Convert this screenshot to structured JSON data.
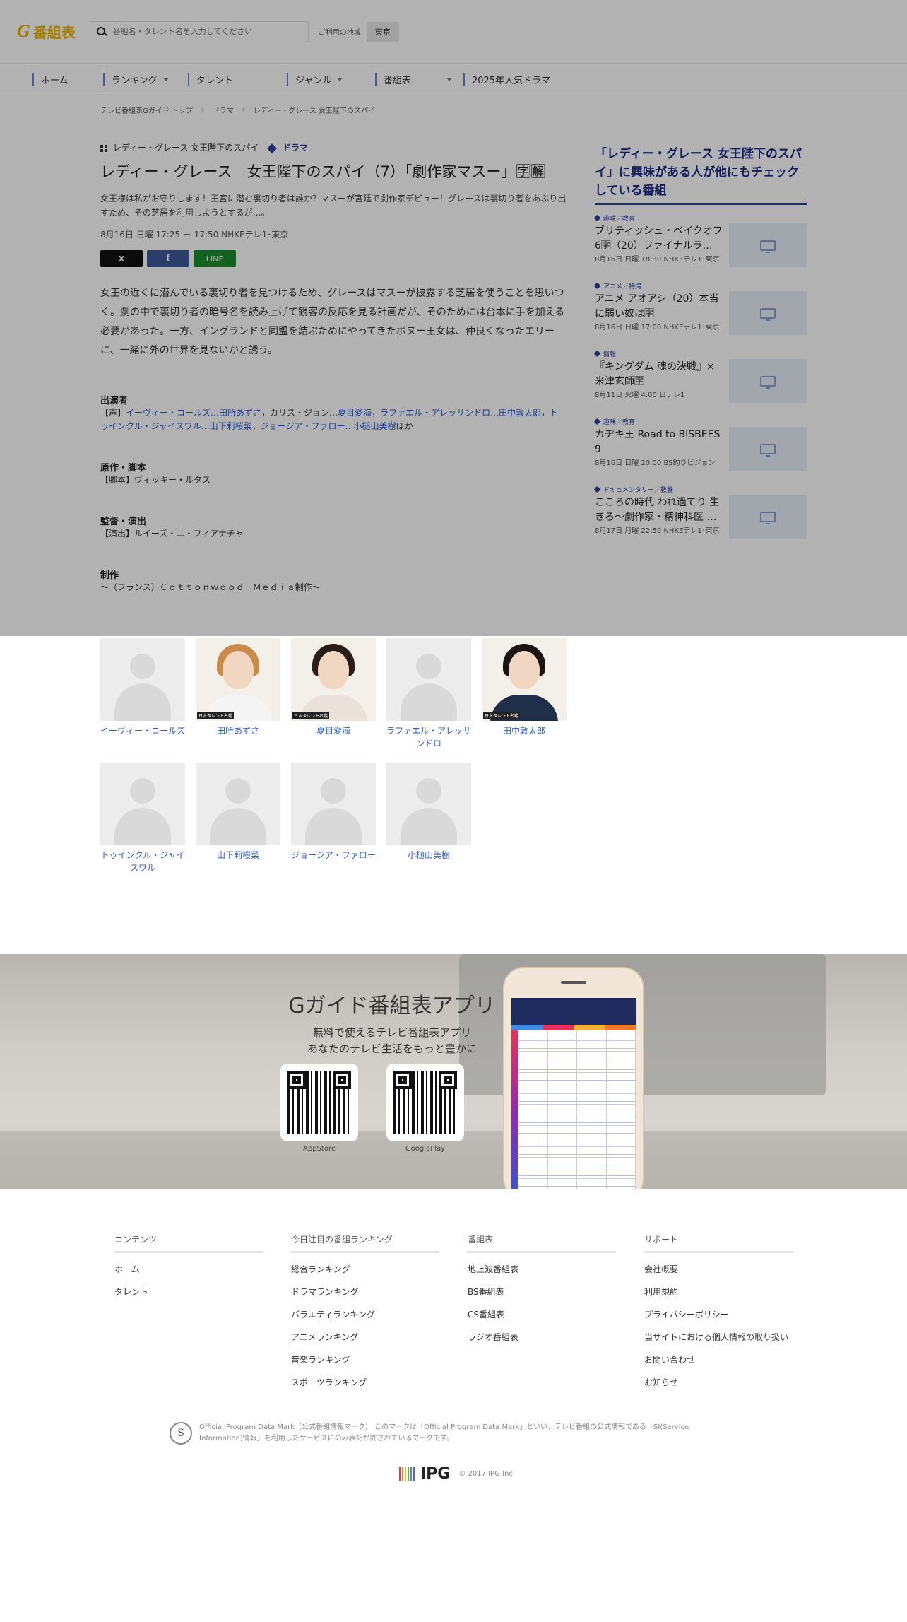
{
  "header": {
    "logo_mark": "G",
    "logo_text": "番組表",
    "search_placeholder": "番組名・タレント名を入力してください",
    "region_label": "ご利用の地域",
    "region_value": "東京"
  },
  "nav": [
    {
      "label": "ホーム",
      "dropdown": false
    },
    {
      "label": "ランキング",
      "dropdown": true
    },
    {
      "label": "タレント",
      "dropdown": false
    },
    {
      "label": "ジャンル",
      "dropdown": true
    },
    {
      "label": "番組表",
      "dropdown": true
    },
    {
      "label": "2025年人気ドラマ",
      "dropdown": false
    }
  ],
  "breadcrumb": [
    "テレビ番組表Gガイド トップ",
    "ドラマ",
    "レディー・グレース 女王陛下のスパイ"
  ],
  "program": {
    "series": "レディー・グレース 女王陛下のスパイ",
    "genre": "ドラマ",
    "title": "レディー・グレース　女王陛下のスパイ（7）「劇作家マスー」🈑🈖",
    "lead": "女王様は私がお守りします！王宮に潜む裏切り者は誰か？マスーが宮廷で劇作家デビュー！グレースは裏切り者をあぶり出すため、その芝居を利用しようとするが…。",
    "airtime": "8月16日 日曜 17:25 － 17:50 NHKEテレ1･東京",
    "share": {
      "x": "X",
      "facebook": "f",
      "line": "LINE"
    },
    "synopsis": "女王の近くに潜んでいる裏切り者を見つけるため、グレースはマスーが披露する芝居を使うことを思いつく。劇の中で裏切り者の暗号名を読み上げて観客の反応を見る計画だが、そのためには台本に手を加える必要があった。一方、イングランドと同盟を結ぶためにやってきたボヌー王女は、仲良くなったエリーに、一緒に外の世界を見ないかと誘う。",
    "cast_heading": "出演者",
    "cast_prefix": "【声】",
    "cast_line": [
      {
        "text": "イーヴィー・コールズ…田所あずさ",
        "link": true
      },
      {
        "text": "，カリス・ジョン…",
        "link": false
      },
      {
        "text": "夏目愛海",
        "link": true
      },
      {
        "text": "，",
        "link": false
      },
      {
        "text": "ラファエル・アレッサンドロ…田中敦太郎",
        "link": true
      },
      {
        "text": "，",
        "link": false
      },
      {
        "text": "トゥインクル・ジャイスワル…山下莉桜菜",
        "link": true
      },
      {
        "text": "，",
        "link": false
      },
      {
        "text": "ジョージア・ファロー…小槌山美樹",
        "link": true
      },
      {
        "text": "ほか",
        "link": false
      }
    ],
    "original_heading": "原作・脚本",
    "original_text": "【脚本】ヴィッキー・ルタス",
    "director_heading": "監督・演出",
    "director_text": "【演出】ルイーズ・ニ・フィアナチャ",
    "production_heading": "制作",
    "production_text": "～（フランス）Ｃｏｔｔｏｎｗｏｏｄ　Ｍｅｄｉａ制作～"
  },
  "sidebar": {
    "heading": "「レディー・グレース 女王陛下のスパイ」に興味がある人が他にもチェックしている番組",
    "items": [
      {
        "genre": "趣味／教育",
        "title": "ブリティッシュ・ベイクオフ6🈑（20）ファイナルラ…",
        "time": "8月16日 日曜 18:30 NHKEテレ1･東京"
      },
      {
        "genre": "アニメ／特撮",
        "title": "アニメ アオアシ（20）本当に弱い奴は🈑",
        "time": "8月16日 日曜 17:00 NHKEテレ1･東京"
      },
      {
        "genre": "情報",
        "title": "『キングダム 魂の決戦』× 米津玄師🈑",
        "time": "8月11日 火曜 4:00 日テレ1"
      },
      {
        "genre": "趣味／教育",
        "title": "カヂキ王 Road to BISBEES 9",
        "time": "8月16日 日曜 20:00 BS釣りビジョン"
      },
      {
        "genre": "ドキュメンタリー／教養",
        "title": "こころの時代 われ過てり 生きろ～劇作家・精神科医 …",
        "time": "8月17日 月曜 22:50 NHKEテレ1･東京"
      }
    ]
  },
  "cast_cards": [
    {
      "name": "イーヴィー・コールズ",
      "photo": "placeholder"
    },
    {
      "name": "田所あずさ",
      "photo": "portrait",
      "credit": "日本タレント名鑑"
    },
    {
      "name": "夏目愛海",
      "photo": "portrait",
      "credit": "日本タレント名鑑"
    },
    {
      "name": "ラファエル・アレッサンドロ",
      "photo": "placeholder"
    },
    {
      "name": "田中敦太郎",
      "photo": "portrait",
      "credit": "日本タレント名鑑"
    },
    {
      "name": "トゥインクル・ジャイスワル",
      "photo": "placeholder"
    },
    {
      "name": "山下莉桜菜",
      "photo": "placeholder"
    },
    {
      "name": "ジョージア・ファロー",
      "photo": "placeholder"
    },
    {
      "name": "小槌山美樹",
      "photo": "placeholder"
    }
  ],
  "app_banner": {
    "title": "Gガイド番組表アプリ",
    "sub1": "無料で使えるテレビ番組表アプリ",
    "sub2": "あなたのテレビ生活をもっと豊かに",
    "store1": "AppStore",
    "store2": "GooglePlay"
  },
  "footer": {
    "columns": [
      {
        "heading": "コンテンツ",
        "links": [
          "ホーム",
          "タレント"
        ]
      },
      {
        "heading": "今日注目の番組ランキング",
        "links": [
          "総合ランキング",
          "ドラマランキング",
          "バラエティランキング",
          "アニメランキング",
          "音楽ランキング",
          "スポーツランキング"
        ]
      },
      {
        "heading": "番組表",
        "links": [
          "地上波番組表",
          "BS番組表",
          "CS番組表",
          "ラジオ番組表"
        ]
      },
      {
        "heading": "サポート",
        "links": [
          "会社概要",
          "利用規約",
          "プライバシーポリシー",
          "当サイトにおける個人情報の取り扱い",
          "お問い合わせ",
          "お知らせ"
        ]
      }
    ],
    "opdm_mark": "S",
    "opdm_text": "Official Program Data Mark（公式番組情報マーク） このマークは「Official Program Data Mark」といい、テレビ番組の公式情報である「SI(Service Information)情報」を利用したサービスにのみ表記が許されているマークです。",
    "ipg_word": "IPG",
    "copyright": "© 2017 IPG Inc."
  },
  "colors": {
    "brand_yellow": "#e9b400",
    "accent_navy": "#2c3e9c",
    "link_blue": "#2a5bd7",
    "line_green": "#1a8f2e"
  }
}
